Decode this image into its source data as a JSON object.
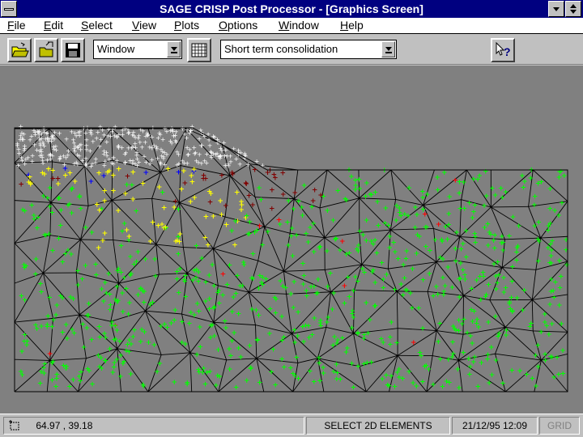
{
  "window": {
    "title": "SAGE CRISP Post Processor - [Graphics Screen]"
  },
  "menu": {
    "items": [
      {
        "label": "File",
        "hotkey": "F"
      },
      {
        "label": "Edit",
        "hotkey": "E"
      },
      {
        "label": "Select",
        "hotkey": "S"
      },
      {
        "label": "View",
        "hotkey": "V"
      },
      {
        "label": "Plots",
        "hotkey": "P"
      },
      {
        "label": "Options",
        "hotkey": "O"
      },
      {
        "label": "Window",
        "hotkey": "W"
      },
      {
        "label": "Help",
        "hotkey": "H"
      }
    ]
  },
  "toolbar": {
    "open_icon": "open-folder-icon",
    "open2_icon": "open-file-icon",
    "save_icon": "floppy-disk-icon",
    "view_select": {
      "value": "Window"
    },
    "grid_icon": "grid-icon",
    "analysis_select": {
      "value": "Short term consolidation"
    },
    "help_icon": "context-help-icon"
  },
  "mesh": {
    "background": "#808080",
    "line_color": "#000000",
    "embankment_color": "#ffffff",
    "marker_colors": [
      "#00ff00",
      "#ffff00",
      "#0000ff",
      "#800000",
      "#ff0000",
      "#ff00ff",
      "#00ffff",
      "#ffffff"
    ]
  },
  "status": {
    "coordinates": "64.97 , 39.18",
    "mode": "SELECT 2D ELEMENTS",
    "datetime": "21/12/95 12:09",
    "grid": "GRID"
  }
}
